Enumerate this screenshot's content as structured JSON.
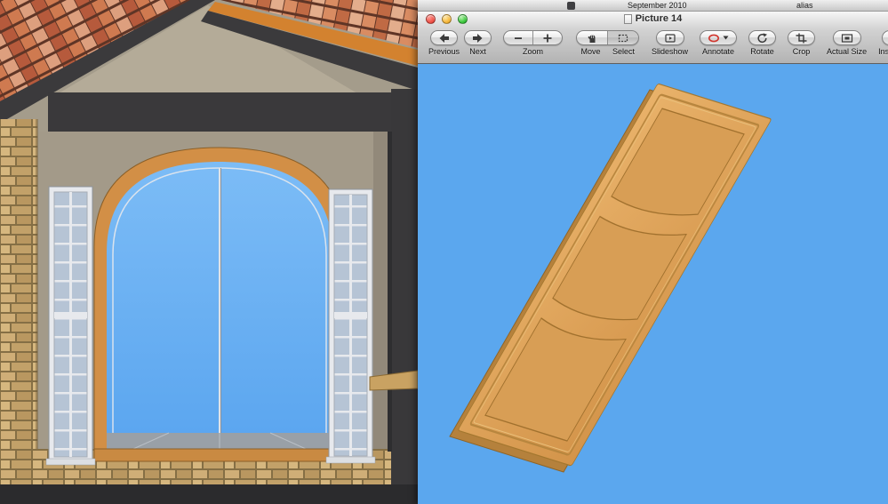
{
  "menubar": {
    "date_label": "September 2010",
    "alias_label": "alias"
  },
  "preview_window": {
    "title": "Picture 14",
    "toolbar": {
      "previous_label": "Previous",
      "next_label": "Next",
      "zoom_label": "Zoom",
      "move_label": "Move",
      "select_label": "Select",
      "slideshow_label": "Slideshow",
      "annotate_label": "Annotate",
      "rotate_label": "Rotate",
      "crop_label": "Crop",
      "actual_size_label": "Actual Size",
      "inspector_label": "Inspector"
    }
  },
  "icons": {
    "inspector_glyph": "i"
  },
  "colors": {
    "content_background": "#5ba7ee",
    "door_face": "#dfa75e",
    "window_frame_orange": "#d28f46",
    "glass_blue": "#66b0f3",
    "wall_tan": "#a49c8b",
    "annotate_accent": "#d0342c"
  }
}
